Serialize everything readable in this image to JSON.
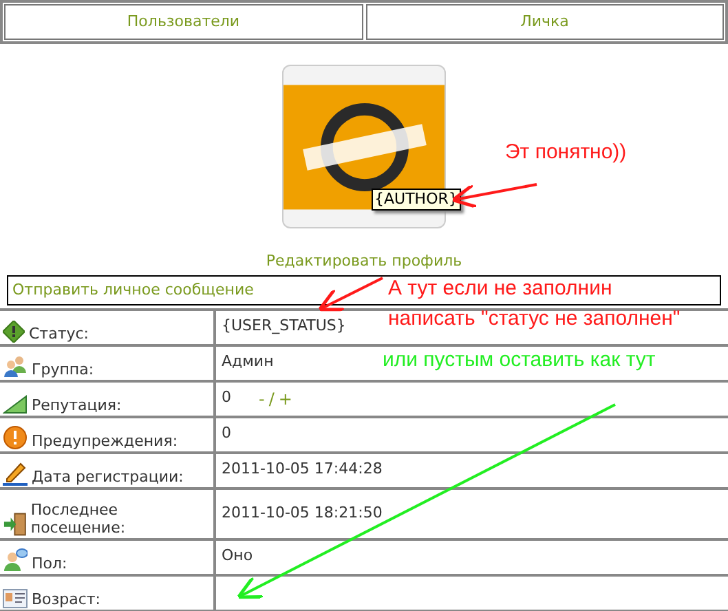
{
  "nav": [
    {
      "label": "Пользователи"
    },
    {
      "label": "Личка"
    }
  ],
  "avatar": {
    "tooltip": "{AUTHOR}"
  },
  "links": {
    "edit_profile": "Редактировать профиль",
    "send_message": "Отправить личное сообщение"
  },
  "profile_rows": [
    {
      "kind": "status",
      "label": "Статус:",
      "value": "{USER_STATUS}"
    },
    {
      "kind": "group",
      "label": "Группа:",
      "value": "Админ"
    },
    {
      "kind": "reputation",
      "label": "Репутация:",
      "value": "0",
      "actions": [
        {
          "label": "-"
        },
        {
          "label": "/"
        },
        {
          "label": "+"
        }
      ]
    },
    {
      "kind": "warning",
      "label": "Предупреждения:",
      "value": "0"
    },
    {
      "kind": "date",
      "label": "Дата регистрации:",
      "value": "2011-10-05 17:44:28"
    },
    {
      "kind": "visit",
      "label": "Последнее посещение:",
      "value": "2011-10-05 18:21:50"
    },
    {
      "kind": "gender",
      "label": "Пол:",
      "value": "Оно"
    },
    {
      "kind": "age",
      "label": "Возраст:"
    }
  ],
  "annotations": [
    {
      "kind": "red",
      "lines": [
        "Эт понятно))"
      ]
    },
    {
      "kind": "red",
      "lines": [
        "А тут если не заполнин",
        "написать \"статус не заполнен\""
      ]
    },
    {
      "kind": "green",
      "lines": [
        "или пустым оставить как тут"
      ]
    }
  ]
}
